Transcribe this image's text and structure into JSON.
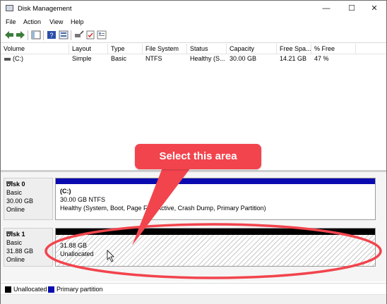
{
  "window": {
    "title": "Disk Management",
    "minimize_icon": "minimize-icon",
    "maximize_icon": "maximize-icon",
    "close_icon": "close-icon"
  },
  "menu": [
    "File",
    "Action",
    "View",
    "Help"
  ],
  "volume_list": {
    "columns": [
      "Volume",
      "Layout",
      "Type",
      "File System",
      "Status",
      "Capacity",
      "Free Spa...",
      "% Free"
    ],
    "rows": [
      {
        "volume": "(C:)",
        "layout": "Simple",
        "type": "Basic",
        "fs": "NTFS",
        "status": "Healthy (S...",
        "capacity": "30.00 GB",
        "free": "14.21 GB",
        "pct": "47 %"
      }
    ]
  },
  "disks": [
    {
      "name": "Disk 0",
      "type": "Basic",
      "size": "30.00 GB",
      "state": "Online",
      "partition": {
        "label": "(C:)",
        "detail": "30.00 GB NTFS",
        "status": "Healthy (System, Boot, Page File, Active, Crash Dump, Primary Partition)"
      }
    },
    {
      "name": "Disk 1",
      "type": "Basic",
      "size": "31.88 GB",
      "state": "Online",
      "partition": {
        "size": "31.88 GB",
        "status": "Unallocated"
      }
    }
  ],
  "legend": [
    {
      "label": "Unallocated",
      "color": "#000000"
    },
    {
      "label": "Primary partition",
      "color": "#0a0ab0"
    }
  ],
  "annotation": {
    "callout_text": "Select this area",
    "color": "#f2444d"
  }
}
